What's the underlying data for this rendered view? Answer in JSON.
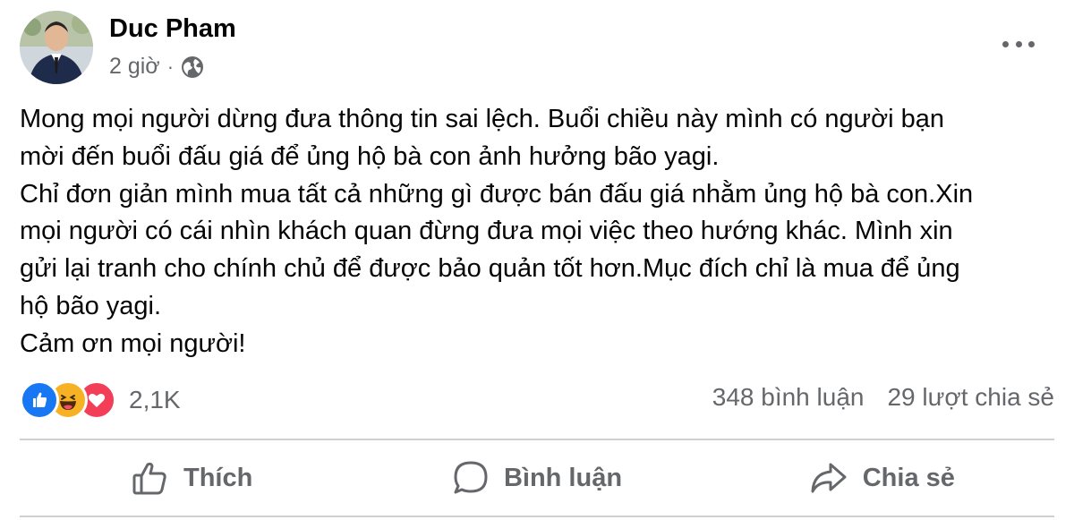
{
  "post": {
    "author": "Duc Pham",
    "time": "2 giờ",
    "separator": "·",
    "privacy_icon": "globe-icon",
    "more_icon": "more-options-icon",
    "content_lines": [
      "Mong mọi người dừng đưa thông tin sai lệch. Buổi chiều này mình có người bạn",
      "mời đến buổi đấu giá để ủng hộ bà con ảnh hưởng bão yagi.",
      "Chỉ đơn giản mình mua tất cả những gì được bán đấu giá nhằm ủng hộ bà con.Xin",
      "mọi người có cái nhìn khách quan đừng đưa mọi việc theo hướng khác. Mình xin",
      "gửi lại tranh cho chính chủ để được bảo quản tốt hơn.Mục đích chỉ là mua để ủng",
      "hộ bão yagi.",
      "Cảm ơn mọi người!"
    ]
  },
  "engagement": {
    "reaction_icons": [
      "like-reaction-icon",
      "haha-reaction-icon",
      "love-reaction-icon"
    ],
    "reaction_count": "2,1K",
    "comments": "348 bình luận",
    "shares": "29 lượt chia sẻ"
  },
  "actions": {
    "like": "Thích",
    "comment": "Bình luận",
    "share": "Chia sẻ"
  },
  "colors": {
    "like_blue": "#1877f2",
    "haha_yellow": "#f7b125",
    "love_red": "#f33e58",
    "secondary_text": "#65676b"
  }
}
